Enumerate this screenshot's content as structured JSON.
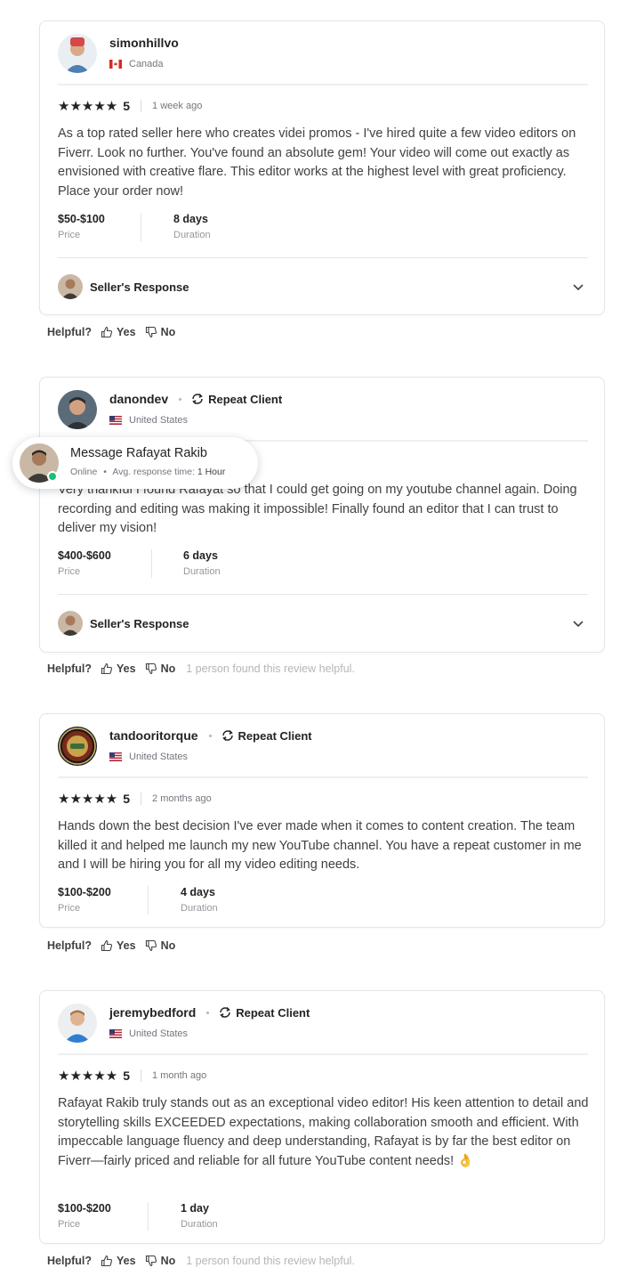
{
  "reviews": [
    {
      "username": "simonhillvo",
      "repeat_label": "",
      "country": "Canada",
      "rating": "5",
      "stars": "★★★★★",
      "time": "1 week ago",
      "text": "As a top rated seller here who creates videi promos - I've hired quite a few video editors on Fiverr. Look no further. You've found an absolute gem! Your video will come out exactly as envisioned with creative flare. This editor works at the highest level with great proficiency. Place your order now!",
      "price": "$50-$100",
      "price_label": "Price",
      "duration": "8 days",
      "duration_label": "Duration",
      "seller_response": "Seller's Response",
      "helpful_note": ""
    },
    {
      "username": "danondev",
      "repeat_label": "Repeat Client",
      "country": "United States",
      "rating": "",
      "stars": "",
      "time": "",
      "text": "Very thankful I found Rafayat so that I could get going on my youtube channel again. Doing recording and editing was making it impossible! Finally found an editor that I can trust to deliver my vision!",
      "price": "$400-$600",
      "price_label": "Price",
      "duration": "6 days",
      "duration_label": "Duration",
      "seller_response": "Seller's Response",
      "helpful_note": "1 person found this review helpful."
    },
    {
      "username": "tandooritorque",
      "repeat_label": "Repeat Client",
      "country": "United States",
      "rating": "5",
      "stars": "★★★★★",
      "time": "2 months ago",
      "text": "Hands down the best decision I've ever made when it comes to content creation. The team killed it and helped me launch my new YouTube channel. You have a repeat customer in me and I will be hiring you for all my video editing needs.",
      "price": "$100-$200",
      "price_label": "Price",
      "duration": "4 days",
      "duration_label": "Duration",
      "seller_response": "",
      "helpful_note": ""
    },
    {
      "username": "jeremybedford",
      "repeat_label": "Repeat Client",
      "country": "United States",
      "rating": "5",
      "stars": "★★★★★",
      "time": "1 month ago",
      "text": "Rafayat Rakib truly stands out as an exceptional video editor! His keen attention to detail and storytelling skills EXCEEDED expectations, making collaboration smooth and efficient. With impeccable language fluency and deep understanding, Rafayat is by far the best editor on Fiverr—fairly priced and reliable for all future YouTube content needs! 👌",
      "price": "$100-$200",
      "price_label": "Price",
      "duration": "1 day",
      "duration_label": "Duration",
      "seller_response": "",
      "helpful_note": "1 person found this review helpful."
    }
  ],
  "helpful": {
    "question": "Helpful?",
    "yes": "Yes",
    "no": "No"
  },
  "message_popup": {
    "title": "Message Rafayat Rakib",
    "status": "Online",
    "response_label": "Avg. response time:",
    "response_value": "1 Hour"
  },
  "colors": {
    "online": "#1dbf73",
    "text": "#404145",
    "border": "#e4e5e7"
  },
  "icons": [
    "repeat-icon",
    "thumbs-up-icon",
    "thumbs-down-icon",
    "chevron-down-icon",
    "canada-flag-icon",
    "us-flag-icon"
  ]
}
